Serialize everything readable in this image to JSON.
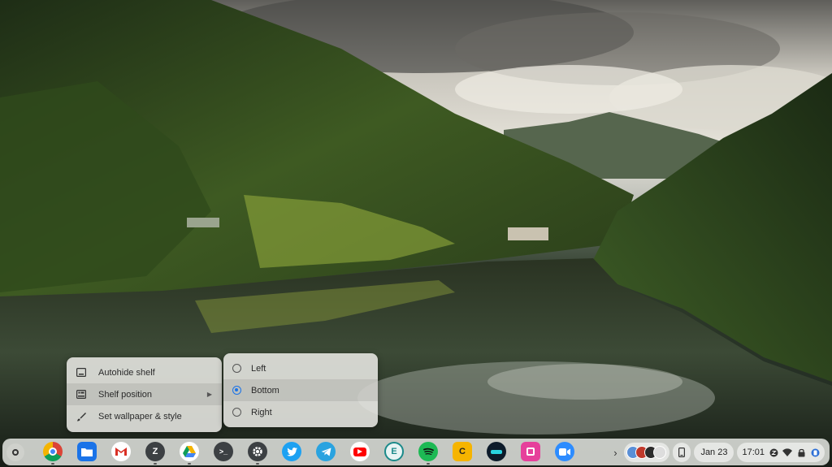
{
  "context_menu": {
    "items": [
      {
        "label": "Autohide shelf"
      },
      {
        "label": "Shelf position"
      },
      {
        "label": "Set wallpaper & style"
      }
    ]
  },
  "shelf_position_submenu": {
    "options": [
      {
        "label": "Left",
        "selected": false
      },
      {
        "label": "Bottom",
        "selected": true
      },
      {
        "label": "Right",
        "selected": false
      }
    ]
  },
  "shelf": {
    "apps": [
      {
        "name": "chrome-icon"
      },
      {
        "name": "files-icon"
      },
      {
        "name": "gmail-icon"
      },
      {
        "name": "zoom-z-icon",
        "glyph": "Z"
      },
      {
        "name": "google-drive-icon"
      },
      {
        "name": "terminal-icon",
        "glyph": ">_"
      },
      {
        "name": "settings-icon"
      },
      {
        "name": "twitter-icon"
      },
      {
        "name": "telegram-icon"
      },
      {
        "name": "youtube-icon"
      },
      {
        "name": "evernote-icon",
        "glyph": "E"
      },
      {
        "name": "spotify-icon"
      },
      {
        "name": "c-app-icon",
        "glyph": "C"
      },
      {
        "name": "media-app-icon"
      },
      {
        "name": "pink-app-icon"
      },
      {
        "name": "zoom-video-icon"
      }
    ],
    "date": "Jan 23",
    "time": "17:01"
  },
  "colors": {
    "accent": "#1a73e8",
    "menu_bg": "#e8e8e4",
    "shelf_bg": "#e2e4e0"
  }
}
